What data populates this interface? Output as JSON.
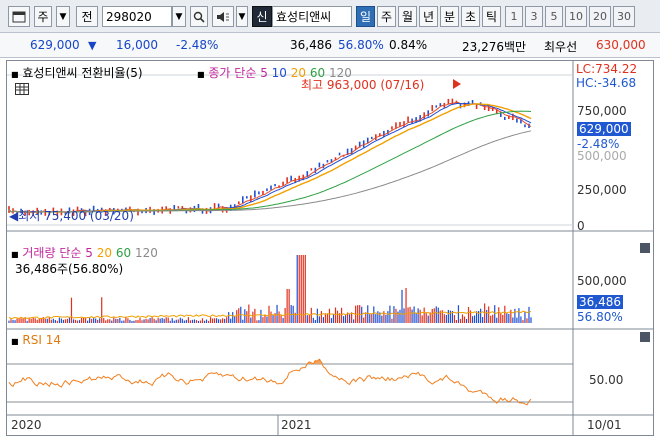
{
  "toolbar": {
    "period_label": "주",
    "prefix_label": "전",
    "code_value": "298020",
    "new_label": "신",
    "company_name": "효성티앤씨",
    "tabs": [
      "일",
      "주",
      "월",
      "년",
      "분",
      "초",
      "틱"
    ],
    "selected_tab": "일",
    "numbers": [
      "1",
      "3",
      "5",
      "10",
      "20",
      "30"
    ]
  },
  "info": {
    "price": "629,000",
    "change": "16,000",
    "change_rate": "-2.48%",
    "volume": "36,486",
    "volume_rate": "56.80%",
    "turnover": "0.84%",
    "amount": "23,276백만",
    "best_label": "최우선",
    "best_price": "630,000"
  },
  "price_panel": {
    "title": "효성티앤씨 전환비율(5)",
    "ma_label": "종가 단순",
    "ma_periods": [
      "5",
      "10",
      "20",
      "60",
      "120"
    ],
    "high_note": "최고 963,000 (07/16)",
    "low_note": "최저 75,400 (03/20)",
    "lc": "LC:734.22",
    "hc": "HC:-34.68",
    "current_price": "629,000",
    "current_change": "-2.48%",
    "y_ticks": [
      "750,000",
      "500,000",
      "250,000",
      "0"
    ]
  },
  "volume_panel": {
    "title": "거래량",
    "ma_label": "단순",
    "ma_periods": [
      "5",
      "20",
      "60",
      "120"
    ],
    "current": "36,486주(56.80%)",
    "current_volume": "36,486",
    "current_rate": "56.80%",
    "y_ticks": [
      "500,000"
    ]
  },
  "rsi_panel": {
    "title": "RSI 14",
    "y_ticks": [
      "50.00"
    ]
  },
  "x_axis": {
    "labels": [
      "2020",
      "2021"
    ],
    "date": "10/01"
  },
  "colors": {
    "ma5": "#e44d2e",
    "ma10": "#1f4fd1",
    "ma20": "#f0a000",
    "ma60": "#2ea043",
    "ma120": "#8a8a8a",
    "rsi": "#f07f1f"
  }
}
